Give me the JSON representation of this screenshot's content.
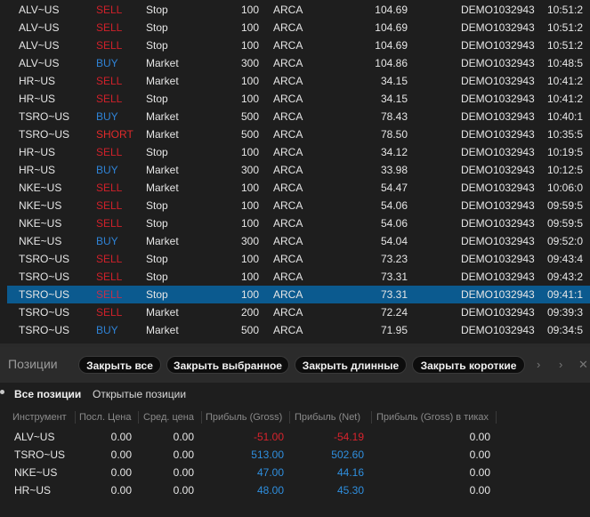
{
  "orders": [
    {
      "symbol": "ALV~US",
      "side": "SELL",
      "type": "Stop",
      "qty": "100",
      "route": "ARCA",
      "price": "104.69",
      "account": "DEMO1032943",
      "time": "10:51:2",
      "side_class": "sell"
    },
    {
      "symbol": "ALV~US",
      "side": "SELL",
      "type": "Stop",
      "qty": "100",
      "route": "ARCA",
      "price": "104.69",
      "account": "DEMO1032943",
      "time": "10:51:2",
      "side_class": "sell"
    },
    {
      "symbol": "ALV~US",
      "side": "SELL",
      "type": "Stop",
      "qty": "100",
      "route": "ARCA",
      "price": "104.69",
      "account": "DEMO1032943",
      "time": "10:51:2",
      "side_class": "sell"
    },
    {
      "symbol": "ALV~US",
      "side": "BUY",
      "type": "Market",
      "qty": "300",
      "route": "ARCA",
      "price": "104.86",
      "account": "DEMO1032943",
      "time": "10:48:5",
      "side_class": "buy"
    },
    {
      "symbol": "HR~US",
      "side": "SELL",
      "type": "Market",
      "qty": "100",
      "route": "ARCA",
      "price": "34.15",
      "account": "DEMO1032943",
      "time": "10:41:2",
      "side_class": "sell"
    },
    {
      "symbol": "HR~US",
      "side": "SELL",
      "type": "Stop",
      "qty": "100",
      "route": "ARCA",
      "price": "34.15",
      "account": "DEMO1032943",
      "time": "10:41:2",
      "side_class": "sell"
    },
    {
      "symbol": "TSRO~US",
      "side": "BUY",
      "type": "Market",
      "qty": "500",
      "route": "ARCA",
      "price": "78.43",
      "account": "DEMO1032943",
      "time": "10:40:1",
      "side_class": "buy"
    },
    {
      "symbol": "TSRO~US",
      "side": "SHORT",
      "type": "Market",
      "qty": "500",
      "route": "ARCA",
      "price": "78.50",
      "account": "DEMO1032943",
      "time": "10:35:5",
      "side_class": "short"
    },
    {
      "symbol": "HR~US",
      "side": "SELL",
      "type": "Stop",
      "qty": "100",
      "route": "ARCA",
      "price": "34.12",
      "account": "DEMO1032943",
      "time": "10:19:5",
      "side_class": "sell"
    },
    {
      "symbol": "HR~US",
      "side": "BUY",
      "type": "Market",
      "qty": "300",
      "route": "ARCA",
      "price": "33.98",
      "account": "DEMO1032943",
      "time": "10:12:5",
      "side_class": "buy"
    },
    {
      "symbol": "NKE~US",
      "side": "SELL",
      "type": "Market",
      "qty": "100",
      "route": "ARCA",
      "price": "54.47",
      "account": "DEMO1032943",
      "time": "10:06:0",
      "side_class": "sell"
    },
    {
      "symbol": "NKE~US",
      "side": "SELL",
      "type": "Stop",
      "qty": "100",
      "route": "ARCA",
      "price": "54.06",
      "account": "DEMO1032943",
      "time": "09:59:5",
      "side_class": "sell"
    },
    {
      "symbol": "NKE~US",
      "side": "SELL",
      "type": "Stop",
      "qty": "100",
      "route": "ARCA",
      "price": "54.06",
      "account": "DEMO1032943",
      "time": "09:59:5",
      "side_class": "sell"
    },
    {
      "symbol": "NKE~US",
      "side": "BUY",
      "type": "Market",
      "qty": "300",
      "route": "ARCA",
      "price": "54.04",
      "account": "DEMO1032943",
      "time": "09:52:0",
      "side_class": "buy"
    },
    {
      "symbol": "TSRO~US",
      "side": "SELL",
      "type": "Stop",
      "qty": "100",
      "route": "ARCA",
      "price": "73.23",
      "account": "DEMO1032943",
      "time": "09:43:4",
      "side_class": "sell"
    },
    {
      "symbol": "TSRO~US",
      "side": "SELL",
      "type": "Stop",
      "qty": "100",
      "route": "ARCA",
      "price": "73.31",
      "account": "DEMO1032943",
      "time": "09:43:2",
      "side_class": "sell"
    },
    {
      "symbol": "TSRO~US",
      "side": "SELL",
      "type": "Stop",
      "qty": "100",
      "route": "ARCA",
      "price": "73.31",
      "account": "DEMO1032943",
      "time": "09:41:1",
      "side_class": "sell",
      "selected": true
    },
    {
      "symbol": "TSRO~US",
      "side": "SELL",
      "type": "Market",
      "qty": "200",
      "route": "ARCA",
      "price": "72.24",
      "account": "DEMO1032943",
      "time": "09:39:3",
      "side_class": "sell"
    },
    {
      "symbol": "TSRO~US",
      "side": "BUY",
      "type": "Market",
      "qty": "500",
      "route": "ARCA",
      "price": "71.95",
      "account": "DEMO1032943",
      "time": "09:34:5",
      "side_class": "buy"
    }
  ],
  "positions": {
    "title": "Позиции",
    "buttons": {
      "close_all": "Закрыть все",
      "close_selected": "Закрыть выбранное",
      "close_long": "Закрыть длинные",
      "close_short": "Закрыть короткие"
    },
    "header_icons": [
      "chevron-right-icon",
      "chevron-right-icon",
      "close-icon"
    ],
    "tabs": {
      "all": "Все позиции",
      "open": "Открытые позиции"
    },
    "columns": [
      "Инструмент",
      "Посл. Цена",
      "Сред. цена",
      "Прибыль (Gross)",
      "Прибыль (Net)",
      "Прибыль (Gross) в тиках"
    ],
    "rows": [
      {
        "symbol": "ALV~US",
        "last": "0.00",
        "avg": "0.00",
        "gross": "-51.00",
        "net": "-54.19",
        "ticks": "0.00",
        "sign": "neg"
      },
      {
        "symbol": "TSRO~US",
        "last": "0.00",
        "avg": "0.00",
        "gross": "513.00",
        "net": "502.60",
        "ticks": "0.00",
        "sign": "pos"
      },
      {
        "symbol": "NKE~US",
        "last": "0.00",
        "avg": "0.00",
        "gross": "47.00",
        "net": "44.16",
        "ticks": "0.00",
        "sign": "pos"
      },
      {
        "symbol": "HR~US",
        "last": "0.00",
        "avg": "0.00",
        "gross": "48.00",
        "net": "45.30",
        "ticks": "0.00",
        "sign": "pos"
      }
    ]
  },
  "colors": {
    "sell": "#d0202a",
    "buy": "#2f83d6",
    "selected_row": "#0b5a8f",
    "profit_positive": "#2f8fdf",
    "profit_negative": "#d9232d"
  }
}
